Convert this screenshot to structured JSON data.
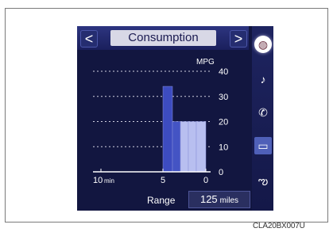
{
  "header": {
    "title": "Consumption",
    "prev_arrow": "<",
    "next_arrow": ">"
  },
  "sidebar": {
    "items": [
      {
        "icon": "fuel-gauge-icon",
        "glyph": "◍",
        "active": true
      },
      {
        "icon": "music-note-icon",
        "glyph": "♪"
      },
      {
        "icon": "phone-icon",
        "glyph": "✆"
      },
      {
        "icon": "car-info-icon",
        "glyph": "▭",
        "highlight": true
      },
      {
        "icon": "climate-fan-icon",
        "glyph": "ఌ"
      }
    ]
  },
  "chart_data": {
    "type": "bar",
    "ylabel": "MPG",
    "ylim": [
      0,
      40
    ],
    "yticks": [
      "40",
      "30",
      "20",
      "10",
      "0"
    ],
    "xticks": [
      "10",
      "5",
      "0"
    ],
    "xunit": "min",
    "bars": [
      {
        "value": 34,
        "color": "#3d4cc0"
      },
      {
        "value": 20,
        "color": "#4454c4"
      },
      {
        "value": 20,
        "color": "#b8bff0"
      },
      {
        "value": 20,
        "color": "#b8bff0"
      },
      {
        "value": 20,
        "color": "#b8bff0"
      }
    ]
  },
  "range": {
    "label": "Range",
    "value": "125",
    "unit": "miles"
  },
  "caption": "CLA20BX007U"
}
